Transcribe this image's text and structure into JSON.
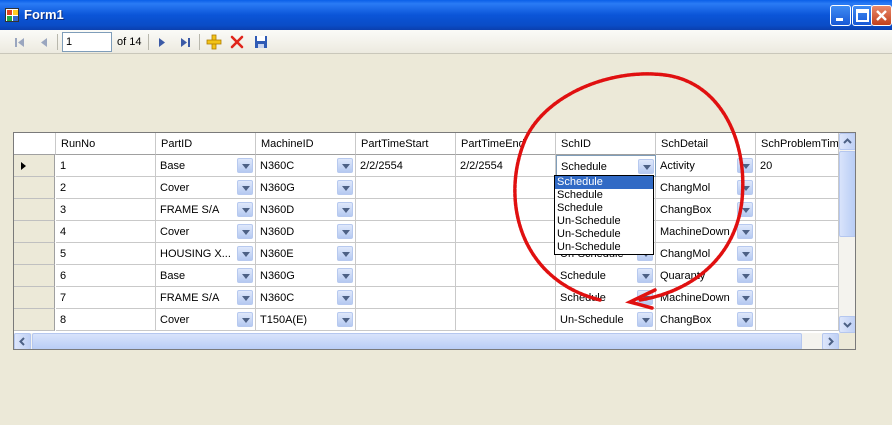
{
  "window": {
    "title": "Form1"
  },
  "navigator": {
    "position": "1",
    "count_label": "of 14"
  },
  "grid": {
    "columns": [
      "RunNo",
      "PartID",
      "MachineID",
      "PartTimeStart",
      "PartTimeEnd",
      "SchID",
      "SchDetail",
      "SchProblemTime"
    ],
    "rows": [
      {
        "runno": "1",
        "partid": "Base",
        "machineid": "N360C",
        "start": "2/2/2554",
        "end": "2/2/2554",
        "schid": "Schedule",
        "schdetail": "Activity",
        "problem": "20"
      },
      {
        "runno": "2",
        "partid": "Cover",
        "machineid": "N360G",
        "start": "",
        "end": "",
        "schid": "",
        "schdetail": "ChangMol",
        "problem": ""
      },
      {
        "runno": "3",
        "partid": "FRAME S/A",
        "machineid": "N360D",
        "start": "",
        "end": "",
        "schid": "",
        "schdetail": "ChangBox",
        "problem": ""
      },
      {
        "runno": "4",
        "partid": "Cover",
        "machineid": "N360D",
        "start": "",
        "end": "",
        "schid": "",
        "schdetail": "MachineDown",
        "problem": ""
      },
      {
        "runno": "5",
        "partid": "HOUSING X...",
        "machineid": "N360E",
        "start": "",
        "end": "",
        "schid": "Un-Schedule",
        "schdetail": "ChangMol",
        "problem": ""
      },
      {
        "runno": "6",
        "partid": "Base",
        "machineid": "N360G",
        "start": "",
        "end": "",
        "schid": "Schedule",
        "schdetail": "Quaranty",
        "problem": ""
      },
      {
        "runno": "7",
        "partid": "FRAME S/A",
        "machineid": "N360C",
        "start": "",
        "end": "",
        "schid": "Schedule",
        "schdetail": "MachineDown",
        "problem": ""
      },
      {
        "runno": "8",
        "partid": "Cover",
        "machineid": "T150A(E)",
        "start": "",
        "end": "",
        "schid": "Un-Schedule",
        "schdetail": "ChangBox",
        "problem": ""
      }
    ]
  },
  "dropdown": {
    "options": [
      "Schedule",
      "Schedule",
      "Schedule",
      "Un-Schedule",
      "Un-Schedule",
      "Un-Schedule"
    ],
    "selected_index": 0
  },
  "colors": {
    "titlebar": "#0a4cc6",
    "annotation": "#e01010",
    "selection": "#316ac5"
  },
  "icons": [
    "move-first-icon",
    "move-previous-icon",
    "move-next-icon",
    "move-last-icon",
    "add-new-icon",
    "delete-icon",
    "save-icon"
  ]
}
